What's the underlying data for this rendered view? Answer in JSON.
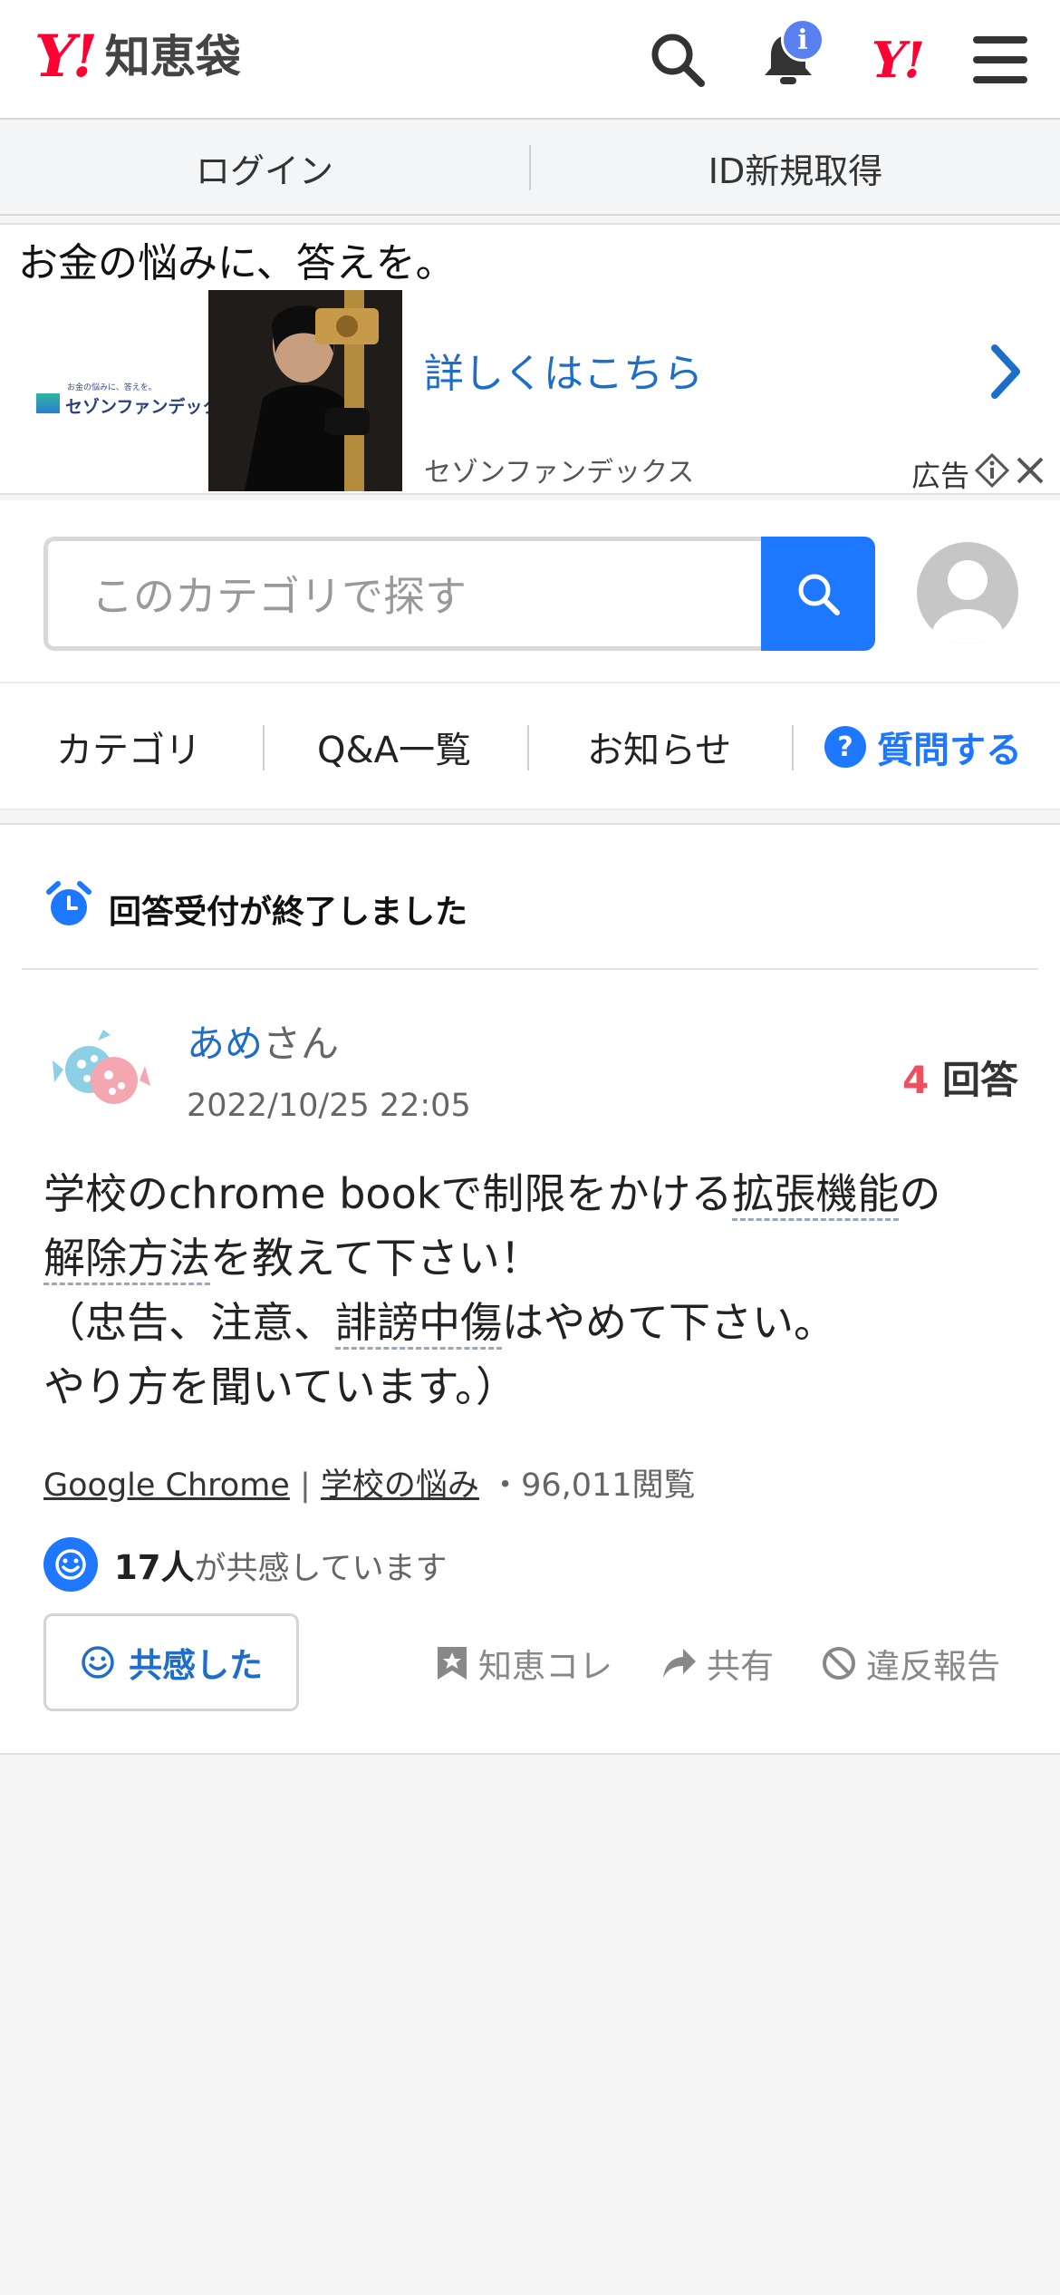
{
  "header": {
    "logo_y": "Y!",
    "logo_text": "知恵袋",
    "notification_badge": "i",
    "yahoo_mark": "Y!"
  },
  "login_bar": {
    "login": "ログイン",
    "register": "ID新規取得"
  },
  "ad": {
    "headline": "お金の悩みに、答えを。",
    "logo_small": "お金の悩みに、答えを。",
    "logo_brand": "セゾンファンデックス",
    "link_text": "詳しくはこちら",
    "advertiser": "セゾンファンデックス",
    "label": "広告"
  },
  "search": {
    "placeholder": "このカテゴリで探す"
  },
  "nav": {
    "items": [
      "カテゴリ",
      "Q&A一覧",
      "お知らせ"
    ],
    "ask": "質問する"
  },
  "question": {
    "status": "回答受付が終了しました",
    "user_name": "あめ",
    "user_suffix": "さん",
    "date": "2022/10/25 22:05",
    "answer_count": "4",
    "answer_label": "回答",
    "body": {
      "p1": "学校のchrome bookで制限をかける",
      "p2": "拡張機能",
      "p3": "の",
      "p4": "解除方法",
      "p5": "を教えて下さい！",
      "p6": "（忠告、注意、",
      "p7": "誹謗中傷",
      "p8": "はやめて下さい。",
      "p9": "やり方を聞いています。）"
    },
    "category1": "Google Chrome",
    "category_sep": "|",
    "category2": "学校の悩み",
    "views": "・96,011閲覧",
    "empathy_count": "17人",
    "empathy_text": "が共感しています",
    "empathy_button": "共感した",
    "actions": {
      "collect": "知恵コレ",
      "share": "共有",
      "report": "違反報告"
    }
  },
  "colors": {
    "brand_red": "#ff0033",
    "accent_blue": "#1e77ff",
    "link_blue": "#1d6ec8",
    "answer_count": "#ef5060"
  }
}
